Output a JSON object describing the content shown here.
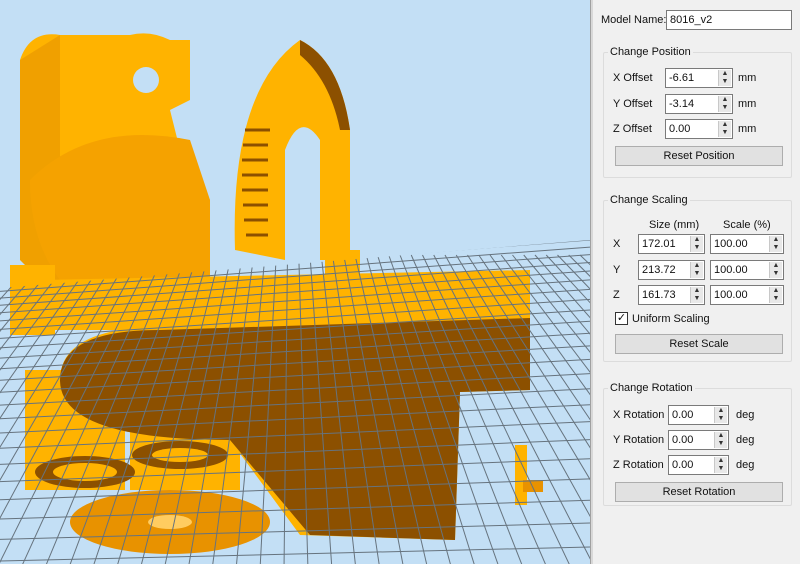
{
  "model_name": {
    "label": "Model Name:",
    "value": "8016_v2"
  },
  "position": {
    "title": "Change Position",
    "rows": [
      {
        "label": "X Offset",
        "value": "-6.61",
        "unit": "mm"
      },
      {
        "label": "Y Offset",
        "value": "-3.14",
        "unit": "mm"
      },
      {
        "label": "Z Offset",
        "value": "0.00",
        "unit": "mm"
      }
    ],
    "reset_label": "Reset Position"
  },
  "scaling": {
    "title": "Change Scaling",
    "size_header": "Size (mm)",
    "scale_header": "Scale (%)",
    "rows": [
      {
        "axis": "X",
        "size": "172.01",
        "scale": "100.00"
      },
      {
        "axis": "Y",
        "size": "213.72",
        "scale": "100.00"
      },
      {
        "axis": "Z",
        "size": "161.73",
        "scale": "100.00"
      }
    ],
    "uniform_label": "Uniform Scaling",
    "uniform_checked": true,
    "check_mark": "✓",
    "reset_label": "Reset Scale"
  },
  "rotation": {
    "title": "Change Rotation",
    "rows": [
      {
        "label": "X Rotation",
        "value": "0.00",
        "unit": "deg"
      },
      {
        "label": "Y Rotation",
        "value": "0.00",
        "unit": "deg"
      },
      {
        "label": "Z Rotation",
        "value": "0.00",
        "unit": "deg"
      }
    ],
    "reset_label": "Reset Rotation"
  },
  "colors": {
    "sky": "#c3dff5",
    "model": "#ffb300",
    "model_shade": "#e89200",
    "model_under": "#8c5000",
    "grid": "#66737e"
  }
}
